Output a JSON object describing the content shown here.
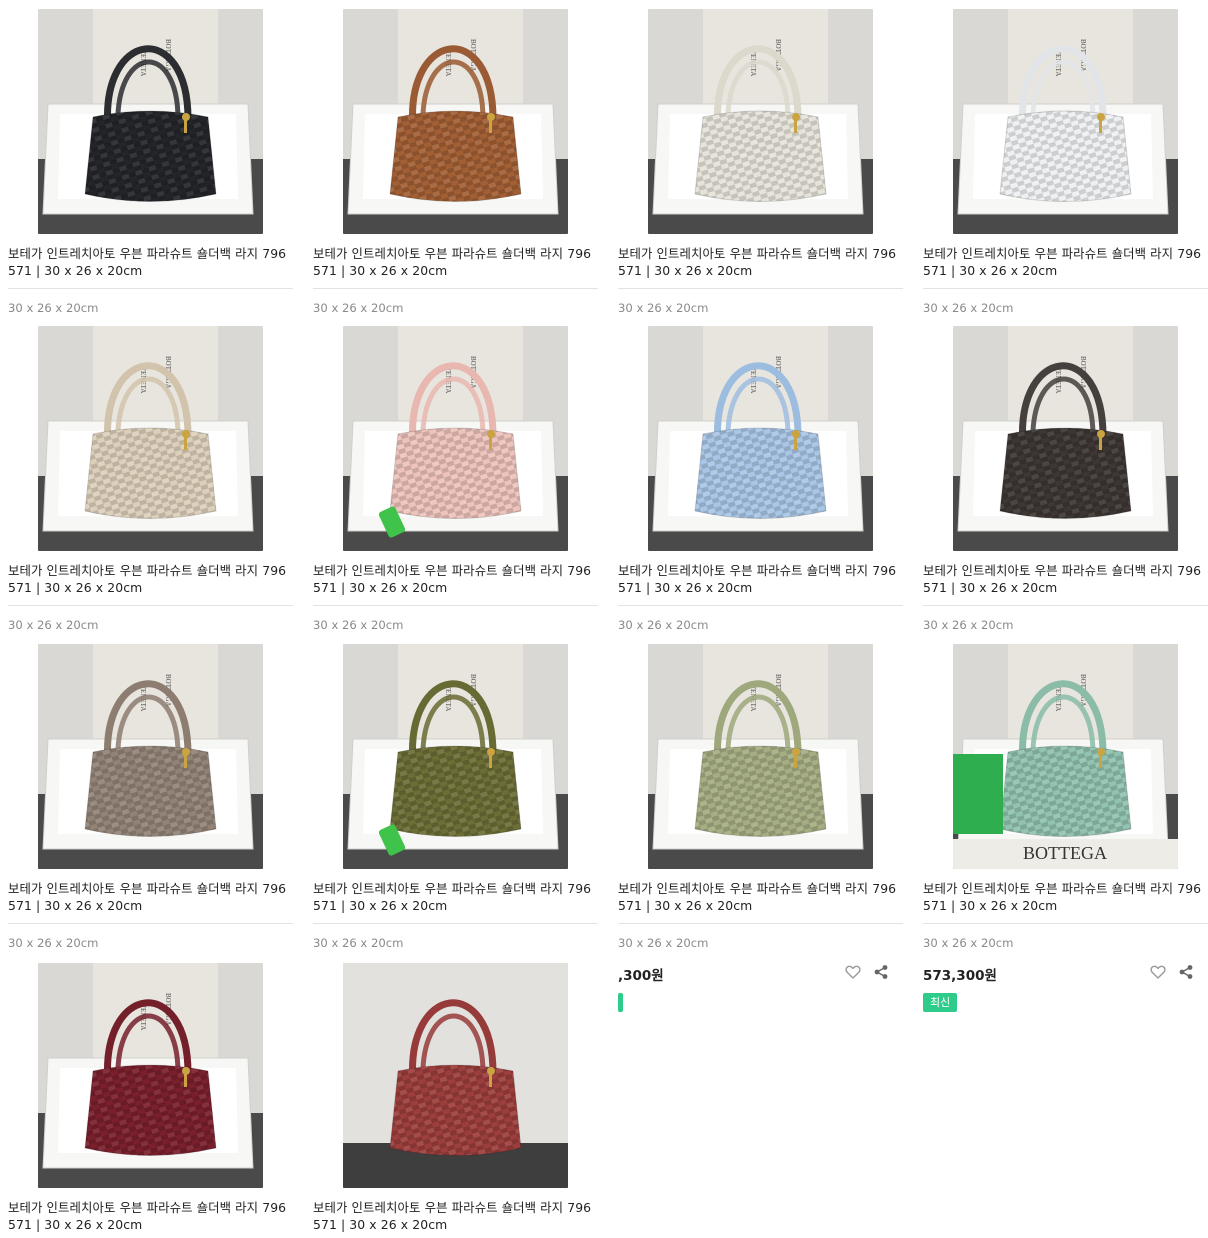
{
  "products": [
    {
      "title": "보테가 인트레치아토 우븐 파라슈트 숄더백 라지 796571 | 30 x 26 x 20cm",
      "size": "30 x 26 x 20cm",
      "bag_color": "#23252a",
      "handle_color": "#2b2d31"
    },
    {
      "title": "보테가 인트레치아토 우븐 파라슈트 숄더백 라지 796571 | 30 x 26 x 20cm",
      "size": "30 x 26 x 20cm",
      "bag_color": "#a35f34",
      "handle_color": "#9a5a33"
    },
    {
      "title": "보테가 인트레치아토 우븐 파라슈트 숄더백 라지 796571 | 30 x 26 x 20cm",
      "size": "30 x 26 x 20cm",
      "bag_color": "#e6e3da",
      "handle_color": "#dcd8cc"
    },
    {
      "title": "보테가 인트레치아토 우븐 파라슈트 숄더백 라지 796571 | 30 x 26 x 20cm",
      "size": "30 x 26 x 20cm",
      "bag_color": "#eef0f2",
      "handle_color": "#e2e5e8"
    },
    {
      "title": "보테가 인트레치아토 우븐 파라슈트 숄더백 라지 796571 | 30 x 26 x 20cm",
      "size": "30 x 26 x 20cm",
      "bag_color": "#ddd0bb",
      "handle_color": "#d2c4ac"
    },
    {
      "title": "보테가 인트레치아토 우븐 파라슈트 숄더백 라지 796571 | 30 x 26 x 20cm",
      "size": "30 x 26 x 20cm",
      "bag_color": "#edc3bc",
      "handle_color": "#e7b7b0"
    },
    {
      "title": "보테가 인트레치아토 우븐 파라슈트 숄더백 라지 796571 | 30 x 26 x 20cm",
      "size": "30 x 26 x 20cm",
      "bag_color": "#a9c6e6",
      "handle_color": "#9dbde0"
    },
    {
      "title": "보테가 인트레치아토 우븐 파라슈트 숄더백 라지 796571 | 30 x 26 x 20cm",
      "size": "30 x 26 x 20cm",
      "bag_color": "#3d3633",
      "handle_color": "#45403d"
    },
    {
      "title": "보테가 인트레치아토 우븐 파라슈트 숄더백 라지 796571 | 30 x 26 x 20cm",
      "size": "30 x 26 x 20cm",
      "bag_color": "#938377",
      "handle_color": "#8d7d71"
    },
    {
      "title": "보테가 인트레치아토 우븐 파라슈트 숄더백 라지 796571 | 30 x 26 x 20cm",
      "size": "30 x 26 x 20cm",
      "bag_color": "#6c6e36",
      "handle_color": "#686a33"
    },
    {
      "title": "보테가 인트레치아토 우븐 파라슈트 숄더백 라지 796571 | 30 x 26 x 20cm",
      "size": "30 x 26 x 20cm",
      "bag_color": "#a5ae82",
      "handle_color": "#9ea87c",
      "price": ",300원",
      "has_actions": true,
      "badge": ""
    },
    {
      "title": "보테가 인트레치아토 우븐 파라슈트 숄더백 라지 796571 | 30 x 26 x 20cm",
      "size": "30 x 26 x 20cm",
      "bag_color": "#92c3b0",
      "handle_color": "#8abca8",
      "price": "573,300원",
      "has_actions": true,
      "badge": "최신"
    },
    {
      "title": "보테가 인트레치아토 우븐 파라슈트 숄더백 라지 796571 | 30 x 26 x 20cm",
      "bag_color": "#7a1f2c",
      "handle_color": "#74202b"
    },
    {
      "title": "보테가 인트레치아토 우븐 파라슈트 숄더백 라지 796571 | 30 x 26 x 20cm",
      "bag_color": "#9c3e3c",
      "handle_color": "#963b39"
    }
  ],
  "photo_text": {
    "box_brand": "BOTTEGA",
    "box_brand_2": "VENETA",
    "dustbag_brand": "BOTTEGA"
  },
  "colors": {
    "badge": "#2ecc8a",
    "divider": "#e3e3e3",
    "muted_text": "#8a8a8a"
  },
  "icons": {
    "like": "heart-outline-icon",
    "share": "share-icon"
  }
}
